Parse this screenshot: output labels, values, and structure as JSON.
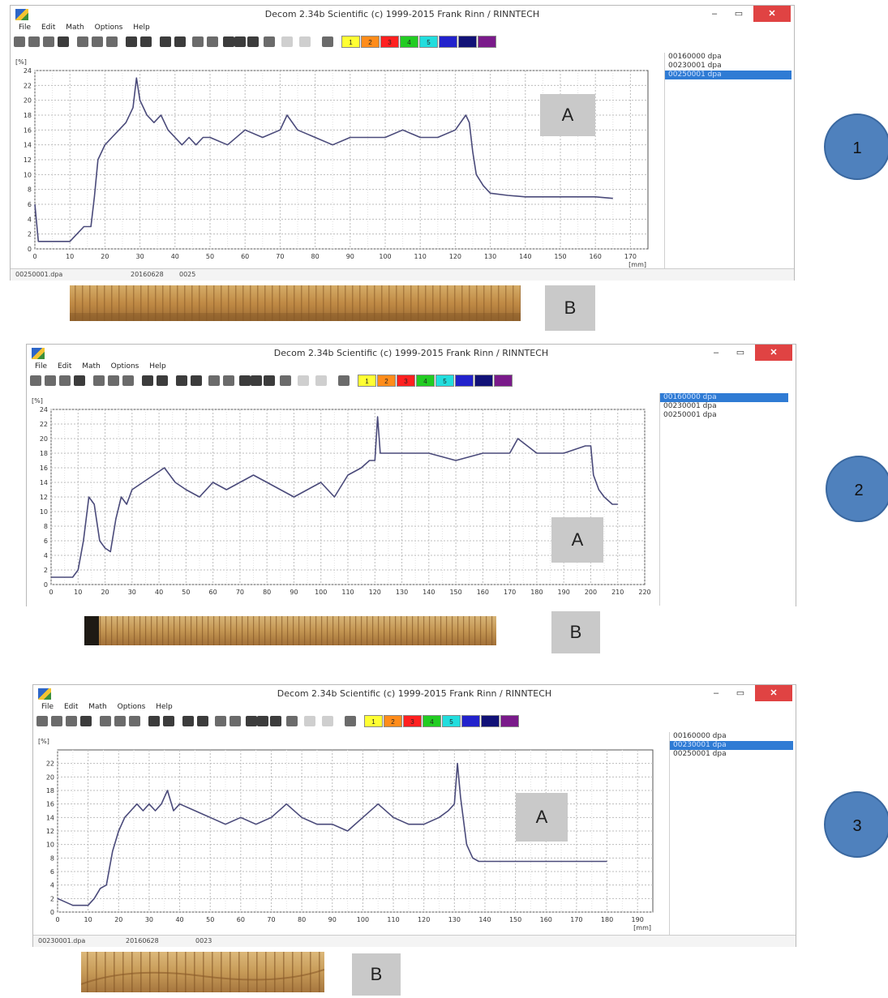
{
  "panels": [
    {
      "badge": "1",
      "window": {
        "title": "Decom 2.34b Scientific  (c) 1999-2015 Frank Rinn / RINNTECH",
        "min_label": "–",
        "max_label": "▭",
        "close_label": "✕",
        "menu": [
          "File",
          "Edit",
          "Math",
          "Options",
          "Help"
        ]
      },
      "color_swatches": [
        {
          "label": "1",
          "color": "#ffff33"
        },
        {
          "label": "2",
          "color": "#ff8c1a"
        },
        {
          "label": "3",
          "color": "#ff2020"
        },
        {
          "label": "4",
          "color": "#22cc22"
        },
        {
          "label": "5",
          "color": "#22dddd"
        },
        {
          "label": "",
          "color": "#2222cc"
        },
        {
          "label": "",
          "color": "#111177"
        },
        {
          "label": "",
          "color": "#7a1a8a"
        }
      ],
      "files": [
        "00160000 dpa",
        "00230001 dpa",
        "00250001 dpa"
      ],
      "selected_file": 2,
      "status": [
        "00250001.dpa",
        "20160628",
        "0025"
      ],
      "label_a": "A",
      "label_b": "B",
      "chart_data": {
        "type": "line",
        "y_unit": "[%]",
        "x_unit": "[mm]",
        "xlim": [
          0,
          175
        ],
        "ylim": [
          0,
          24
        ],
        "x_ticks": [
          0,
          10,
          20,
          30,
          40,
          50,
          60,
          70,
          80,
          90,
          100,
          110,
          120,
          130,
          140,
          150,
          160,
          170
        ],
        "y_ticks": [
          0,
          2,
          4,
          6,
          8,
          10,
          12,
          14,
          16,
          18,
          20,
          22,
          24
        ],
        "grid": true,
        "series": [
          {
            "color": "#4a4a7a",
            "x": [
              0,
              1,
              2,
              10,
              12,
              14,
              16,
              17,
              18,
              20,
              22,
              24,
              26,
              28,
              29,
              30,
              32,
              34,
              36,
              38,
              40,
              42,
              44,
              46,
              48,
              50,
              55,
              60,
              65,
              70,
              72,
              75,
              80,
              85,
              90,
              95,
              100,
              105,
              110,
              115,
              120,
              123,
              124,
              125,
              126,
              128,
              130,
              135,
              140,
              150,
              160,
              165
            ],
            "y": [
              6,
              1,
              1,
              1,
              2,
              3,
              3,
              7,
              12,
              14,
              15,
              16,
              17,
              19,
              23,
              20,
              18,
              17,
              18,
              16,
              15,
              14,
              15,
              14,
              15,
              15,
              14,
              16,
              15,
              16,
              18,
              16,
              15,
              14,
              15,
              15,
              15,
              16,
              15,
              15,
              16,
              18,
              17,
              13,
              10,
              8.5,
              7.5,
              7.2,
              7,
              7,
              7,
              6.8
            ]
          }
        ]
      }
    },
    {
      "badge": "2",
      "window": {
        "title": "Decom 2.34b Scientific  (c) 1999-2015 Frank Rinn / RINNTECH",
        "min_label": "–",
        "max_label": "▭",
        "close_label": "✕",
        "menu": [
          "File",
          "Edit",
          "Math",
          "Options",
          "Help"
        ]
      },
      "color_swatches": [
        {
          "label": "1",
          "color": "#ffff33"
        },
        {
          "label": "2",
          "color": "#ff8c1a"
        },
        {
          "label": "3",
          "color": "#ff2020"
        },
        {
          "label": "4",
          "color": "#22cc22"
        },
        {
          "label": "5",
          "color": "#22dddd"
        },
        {
          "label": "",
          "color": "#2222cc"
        },
        {
          "label": "",
          "color": "#111177"
        },
        {
          "label": "",
          "color": "#7a1a8a"
        }
      ],
      "files": [
        "00160000 dpa",
        "00230001 dpa",
        "00250001 dpa"
      ],
      "selected_file": 0,
      "status": [],
      "label_a": "A",
      "label_b": "B",
      "chart_data": {
        "type": "line",
        "y_unit": "[%]",
        "x_unit": "",
        "xlim": [
          0,
          220
        ],
        "ylim": [
          0,
          24
        ],
        "x_ticks": [
          0,
          10,
          20,
          30,
          40,
          50,
          60,
          70,
          80,
          90,
          100,
          110,
          120,
          130,
          140,
          150,
          160,
          170,
          180,
          190,
          200,
          210,
          220
        ],
        "y_ticks": [
          0,
          2,
          4,
          6,
          8,
          10,
          12,
          14,
          16,
          18,
          20,
          22,
          24
        ],
        "grid": true,
        "series": [
          {
            "color": "#4a4a7a",
            "x": [
              0,
              5,
              8,
              10,
              12,
              14,
              16,
              18,
              20,
              22,
              24,
              26,
              28,
              30,
              34,
              38,
              42,
              46,
              50,
              55,
              60,
              65,
              70,
              75,
              80,
              85,
              90,
              95,
              100,
              105,
              110,
              115,
              118,
              120,
              121,
              122,
              125,
              130,
              140,
              150,
              160,
              170,
              173,
              180,
              190,
              198,
              200,
              201,
              203,
              205,
              208,
              210
            ],
            "y": [
              1,
              1,
              1,
              2,
              6,
              12,
              11,
              6,
              5,
              4.5,
              9,
              12,
              11,
              13,
              14,
              15,
              16,
              14,
              13,
              12,
              14,
              13,
              14,
              15,
              14,
              13,
              12,
              13,
              14,
              12,
              15,
              16,
              17,
              17,
              23,
              18,
              18,
              18,
              18,
              17,
              18,
              18,
              20,
              18,
              18,
              19,
              19,
              15,
              13,
              12,
              11,
              11
            ]
          }
        ]
      }
    },
    {
      "badge": "3",
      "window": {
        "title": "Decom 2.34b Scientific  (c) 1999-2015 Frank Rinn / RINNTECH",
        "min_label": "–",
        "max_label": "▭",
        "close_label": "✕",
        "menu": [
          "File",
          "Edit",
          "Math",
          "Options",
          "Help"
        ]
      },
      "color_swatches": [
        {
          "label": "1",
          "color": "#ffff33"
        },
        {
          "label": "2",
          "color": "#ff8c1a"
        },
        {
          "label": "3",
          "color": "#ff2020"
        },
        {
          "label": "4",
          "color": "#22cc22"
        },
        {
          "label": "5",
          "color": "#22dddd"
        },
        {
          "label": "",
          "color": "#2222cc"
        },
        {
          "label": "",
          "color": "#111177"
        },
        {
          "label": "",
          "color": "#7a1a8a"
        }
      ],
      "files": [
        "00160000 dpa",
        "00230001 dpa",
        "00250001 dpa"
      ],
      "selected_file": 1,
      "status": [
        "00230001.dpa",
        "20160628",
        "0023"
      ],
      "label_a": "A",
      "label_b": "B",
      "chart_data": {
        "type": "line",
        "y_unit": "[%]",
        "x_unit": "[mm]",
        "xlim": [
          0,
          195
        ],
        "ylim": [
          0,
          24
        ],
        "x_ticks": [
          0,
          10,
          20,
          30,
          40,
          50,
          60,
          70,
          80,
          90,
          100,
          110,
          120,
          130,
          140,
          150,
          160,
          170,
          180,
          190
        ],
        "y_ticks": [
          0,
          2,
          4,
          6,
          8,
          10,
          12,
          14,
          16,
          18,
          20,
          22
        ],
        "grid": true,
        "series": [
          {
            "color": "#4a4a7a",
            "x": [
              0,
              5,
              10,
              12,
              14,
              16,
              18,
              20,
              22,
              24,
              26,
              28,
              30,
              32,
              34,
              36,
              38,
              40,
              45,
              50,
              55,
              60,
              65,
              70,
              75,
              80,
              85,
              90,
              95,
              100,
              105,
              110,
              115,
              120,
              125,
              128,
              130,
              131,
              132,
              134,
              136,
              138,
              140,
              150,
              160,
              170,
              180
            ],
            "y": [
              2,
              1,
              1,
              2,
              3.5,
              4,
              9,
              12,
              14,
              15,
              16,
              15,
              16,
              15,
              16,
              18,
              15,
              16,
              15,
              14,
              13,
              14,
              13,
              14,
              16,
              14,
              13,
              13,
              12,
              14,
              16,
              14,
              13,
              13,
              14,
              15,
              16,
              22,
              17,
              10,
              8,
              7.5,
              7.5,
              7.5,
              7.5,
              7.5,
              7.5
            ]
          }
        ]
      }
    }
  ]
}
